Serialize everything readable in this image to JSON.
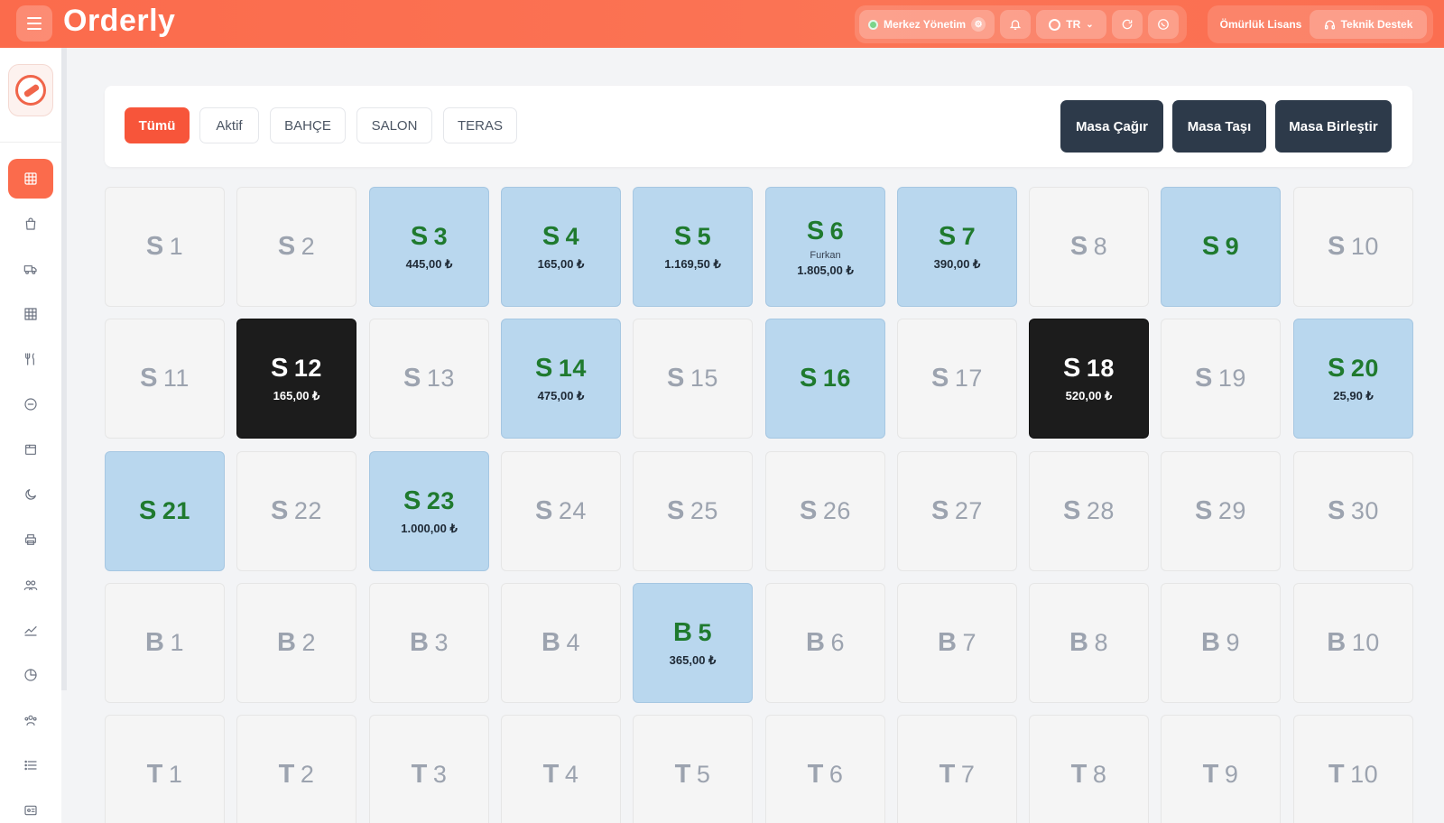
{
  "app": {
    "brand": "Orderly"
  },
  "header": {
    "merkez_label": "Merkez Yönetim",
    "language": "TR",
    "license_label": "Ömürlük Lisans",
    "support_label": "Teknik Destek"
  },
  "sidebar": {
    "items": [
      {
        "name": "tables-icon",
        "active": true
      },
      {
        "name": "shopping-bag-icon"
      },
      {
        "name": "delivery-truck-icon"
      },
      {
        "name": "grid-icon"
      },
      {
        "name": "cutlery-icon"
      },
      {
        "name": "minus-circle-icon"
      },
      {
        "name": "package-icon"
      },
      {
        "name": "moon-icon"
      },
      {
        "name": "printer-icon"
      },
      {
        "name": "users-icon"
      },
      {
        "name": "trend-icon"
      },
      {
        "name": "pie-chart-icon"
      },
      {
        "name": "team-icon"
      },
      {
        "name": "list-icon"
      },
      {
        "name": "id-card-icon"
      }
    ]
  },
  "filters": {
    "tabs": [
      "Tümü",
      "Aktif",
      "BAHÇE",
      "SALON",
      "TERAS"
    ],
    "active_index": 0,
    "actions": [
      "Masa Çağır",
      "Masa Taşı",
      "Masa Birleştir"
    ]
  },
  "tables": [
    {
      "prefix": "S",
      "num": "1",
      "state": "empty"
    },
    {
      "prefix": "S",
      "num": "2",
      "state": "empty"
    },
    {
      "prefix": "S",
      "num": "3",
      "state": "occupied",
      "amount": "445,00 ₺"
    },
    {
      "prefix": "S",
      "num": "4",
      "state": "occupied",
      "amount": "165,00 ₺"
    },
    {
      "prefix": "S",
      "num": "5",
      "state": "occupied",
      "amount": "1.169,50 ₺"
    },
    {
      "prefix": "S",
      "num": "6",
      "state": "occupied",
      "guest": "Furkan",
      "amount": "1.805,00 ₺"
    },
    {
      "prefix": "S",
      "num": "7",
      "state": "occupied",
      "amount": "390,00 ₺"
    },
    {
      "prefix": "S",
      "num": "8",
      "state": "empty"
    },
    {
      "prefix": "S",
      "num": "9",
      "state": "occupied"
    },
    {
      "prefix": "S",
      "num": "10",
      "state": "empty"
    },
    {
      "prefix": "S",
      "num": "11",
      "state": "empty"
    },
    {
      "prefix": "S",
      "num": "12",
      "state": "dark",
      "amount": "165,00 ₺"
    },
    {
      "prefix": "S",
      "num": "13",
      "state": "empty"
    },
    {
      "prefix": "S",
      "num": "14",
      "state": "occupied",
      "amount": "475,00 ₺"
    },
    {
      "prefix": "S",
      "num": "15",
      "state": "empty"
    },
    {
      "prefix": "S",
      "num": "16",
      "state": "occupied"
    },
    {
      "prefix": "S",
      "num": "17",
      "state": "empty"
    },
    {
      "prefix": "S",
      "num": "18",
      "state": "dark",
      "amount": "520,00 ₺"
    },
    {
      "prefix": "S",
      "num": "19",
      "state": "empty"
    },
    {
      "prefix": "S",
      "num": "20",
      "state": "occupied",
      "amount": "25,90 ₺"
    },
    {
      "prefix": "S",
      "num": "21",
      "state": "occupied"
    },
    {
      "prefix": "S",
      "num": "22",
      "state": "empty"
    },
    {
      "prefix": "S",
      "num": "23",
      "state": "occupied",
      "amount": "1.000,00 ₺"
    },
    {
      "prefix": "S",
      "num": "24",
      "state": "empty"
    },
    {
      "prefix": "S",
      "num": "25",
      "state": "empty"
    },
    {
      "prefix": "S",
      "num": "26",
      "state": "empty"
    },
    {
      "prefix": "S",
      "num": "27",
      "state": "empty"
    },
    {
      "prefix": "S",
      "num": "28",
      "state": "empty"
    },
    {
      "prefix": "S",
      "num": "29",
      "state": "empty"
    },
    {
      "prefix": "S",
      "num": "30",
      "state": "empty"
    },
    {
      "prefix": "B",
      "num": "1",
      "state": "empty"
    },
    {
      "prefix": "B",
      "num": "2",
      "state": "empty"
    },
    {
      "prefix": "B",
      "num": "3",
      "state": "empty"
    },
    {
      "prefix": "B",
      "num": "4",
      "state": "empty"
    },
    {
      "prefix": "B",
      "num": "5",
      "state": "occupied",
      "amount": "365,00 ₺"
    },
    {
      "prefix": "B",
      "num": "6",
      "state": "empty"
    },
    {
      "prefix": "B",
      "num": "7",
      "state": "empty"
    },
    {
      "prefix": "B",
      "num": "8",
      "state": "empty"
    },
    {
      "prefix": "B",
      "num": "9",
      "state": "empty"
    },
    {
      "prefix": "B",
      "num": "10",
      "state": "empty"
    },
    {
      "prefix": "T",
      "num": "1",
      "state": "empty"
    },
    {
      "prefix": "T",
      "num": "2",
      "state": "empty"
    },
    {
      "prefix": "T",
      "num": "3",
      "state": "empty"
    },
    {
      "prefix": "T",
      "num": "4",
      "state": "empty"
    },
    {
      "prefix": "T",
      "num": "5",
      "state": "empty"
    },
    {
      "prefix": "T",
      "num": "6",
      "state": "empty"
    },
    {
      "prefix": "T",
      "num": "7",
      "state": "empty"
    },
    {
      "prefix": "T",
      "num": "8",
      "state": "empty"
    },
    {
      "prefix": "T",
      "num": "9",
      "state": "empty"
    },
    {
      "prefix": "T",
      "num": "10",
      "state": "empty"
    }
  ],
  "colors": {
    "accent": "#fb6b4c",
    "occupied_bg": "#b9d7ee",
    "occupied_text": "#1f7a2e",
    "dark_table": "#1c1c1c",
    "action_btn": "#2d3a4a"
  }
}
